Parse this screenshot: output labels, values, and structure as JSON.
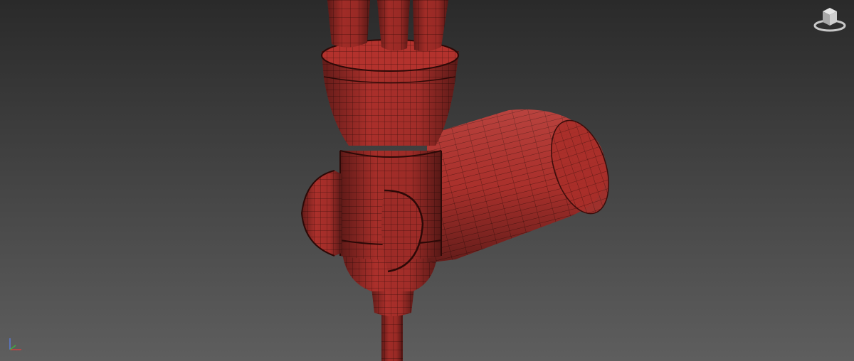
{
  "viewport": {
    "background_top": "#2b2b2b",
    "background_bottom": "#5b5b5b"
  },
  "model": {
    "color": "#b5302c",
    "wire_color": "#3a0d0b"
  },
  "icons": {
    "viewcube": "viewcube-icon",
    "axis": "axis-tripod-icon"
  }
}
